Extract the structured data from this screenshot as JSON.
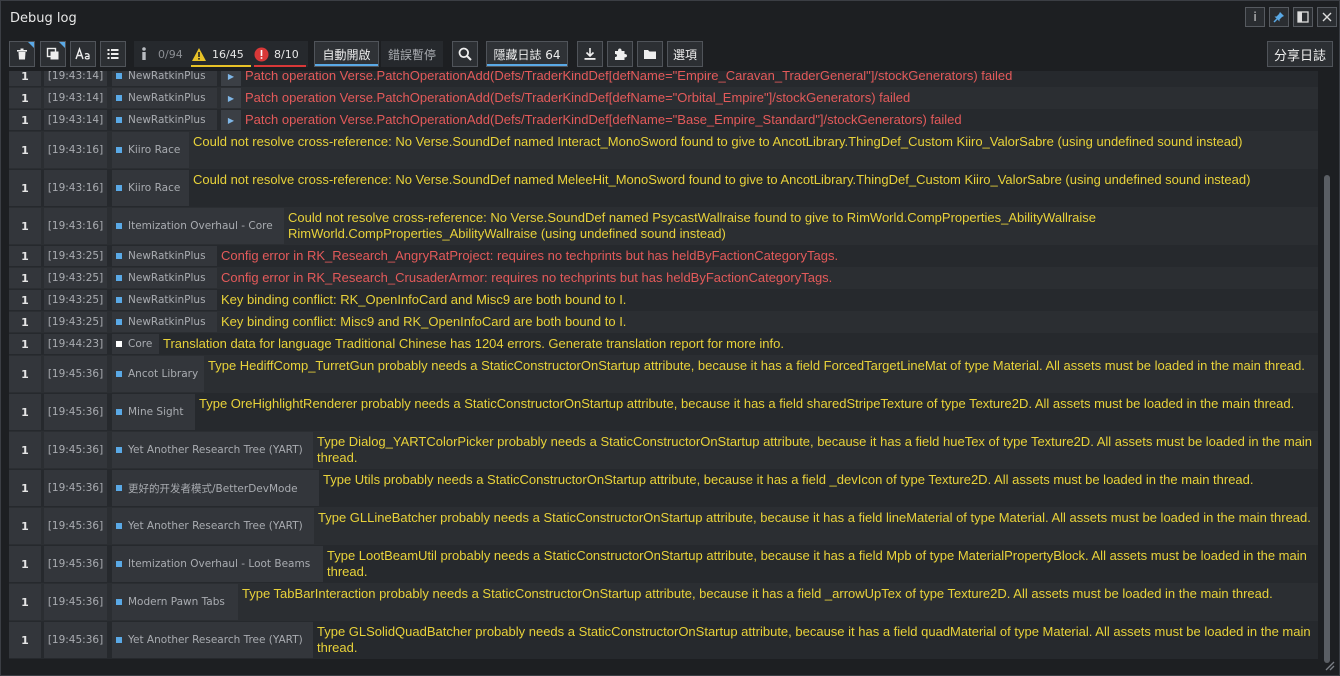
{
  "window": {
    "title": "Debug log",
    "buttons": {
      "info": "i",
      "pin": "pin-icon",
      "dock": "dock-icon",
      "close": "close-icon"
    }
  },
  "toolbar": {
    "counts": {
      "info": "0/94",
      "warning": "16/45",
      "error": "8/10"
    },
    "auto_open": "自動開啟",
    "pause_on_error": "錯誤暫停",
    "hide_logs": "隱藏日誌 64",
    "options": "選項",
    "share": "分享日誌"
  },
  "colors": {
    "error": "#e35a5a",
    "warning": "#e8d23a",
    "accent": "#5aa9e6",
    "warn_badge": "#e8c227",
    "err_badge": "#d93838"
  },
  "rows": [
    {
      "count": "1",
      "time": "[19:43:14]",
      "mod": "NewRatkinPlus",
      "expand": true,
      "type": "error",
      "message": "Patch operation Verse.PatchOperationAdd(Defs/TraderKindDef[defName=\"Empire_Caravan_TraderGeneral\"]/stockGenerators) failed"
    },
    {
      "count": "1",
      "time": "[19:43:14]",
      "mod": "NewRatkinPlus",
      "expand": true,
      "type": "error",
      "message": "Patch operation Verse.PatchOperationAdd(Defs/TraderKindDef[defName=\"Orbital_Empire\"]/stockGenerators) failed"
    },
    {
      "count": "1",
      "time": "[19:43:14]",
      "mod": "NewRatkinPlus",
      "expand": true,
      "type": "error",
      "message": "Patch operation Verse.PatchOperationAdd(Defs/TraderKindDef[defName=\"Base_Empire_Standard\"]/stockGenerators) failed"
    },
    {
      "count": "1",
      "time": "[19:43:16]",
      "mod": "Kiiro Race",
      "type": "warn",
      "message": "Could not resolve cross-reference: No Verse.SoundDef named Interact_MonoSword found to give to AncotLibrary.ThingDef_Custom Kiiro_ValorSabre (using undefined sound instead)"
    },
    {
      "count": "1",
      "time": "[19:43:16]",
      "mod": "Kiiro Race",
      "type": "warn",
      "message": "Could not resolve cross-reference: No Verse.SoundDef named MeleeHit_MonoSword found to give to AncotLibrary.ThingDef_Custom Kiiro_ValorSabre (using undefined sound instead)"
    },
    {
      "count": "1",
      "time": "[19:43:16]",
      "mod": "Itemization Overhaul - Core",
      "type": "warn",
      "message": "Could not resolve cross-reference: No Verse.SoundDef named PsycastWallraise found to give to RimWorld.CompProperties_AbilityWallraise RimWorld.CompProperties_AbilityWallraise (using undefined sound instead)"
    },
    {
      "count": "1",
      "time": "[19:43:25]",
      "mod": "NewRatkinPlus",
      "type": "error",
      "message": "Config error in RK_Research_AngryRatProject: requires no techprints but has heldByFactionCategoryTags."
    },
    {
      "count": "1",
      "time": "[19:43:25]",
      "mod": "NewRatkinPlus",
      "type": "error",
      "message": "Config error in RK_Research_CrusaderArmor: requires no techprints but has heldByFactionCategoryTags."
    },
    {
      "count": "1",
      "time": "[19:43:25]",
      "mod": "NewRatkinPlus",
      "type": "warn",
      "message": "Key binding conflict: RK_OpenInfoCard and Misc9 are both bound to I."
    },
    {
      "count": "1",
      "time": "[19:43:25]",
      "mod": "NewRatkinPlus",
      "type": "warn",
      "message": "Key binding conflict: Misc9 and RK_OpenInfoCard are both bound to I."
    },
    {
      "count": "1",
      "time": "[19:44:23]",
      "mod": "Core",
      "type": "warn",
      "message": "Translation data for language Traditional Chinese has 1204 errors. Generate translation report for more info."
    },
    {
      "count": "1",
      "time": "[19:45:36]",
      "mod": "Ancot Library",
      "type": "warn",
      "message": "Type HediffComp_TurretGun probably needs a StaticConstructorOnStartup attribute, because it has a field ForcedTargetLineMat of type Material. All assets must be loaded in the main thread."
    },
    {
      "count": "1",
      "time": "[19:45:36]",
      "mod": "Mine Sight",
      "type": "warn",
      "message": "Type OreHighlightRenderer probably needs a StaticConstructorOnStartup attribute, because it has a field sharedStripeTexture of type Texture2D. All assets must be loaded in the main thread."
    },
    {
      "count": "1",
      "time": "[19:45:36]",
      "mod": "Yet Another Research Tree (YART)",
      "type": "warn",
      "message": "Type Dialog_YARTColorPicker probably needs a StaticConstructorOnStartup attribute, because it has a field hueTex of type Texture2D. All assets must be loaded in the main thread."
    },
    {
      "count": "1",
      "time": "[19:45:36]",
      "mod": "更好的开发者模式/BetterDevMode",
      "type": "warn",
      "message": "Type Utils probably needs a StaticConstructorOnStartup attribute, because it has a field _devIcon of type Texture2D. All assets must be loaded in the main thread."
    },
    {
      "count": "1",
      "time": "[19:45:36]",
      "mod": "Yet Another Research Tree (YART)",
      "type": "warn",
      "message": "Type GLLineBatcher probably needs a StaticConstructorOnStartup attribute, because it has a field lineMaterial of type Material. All assets must be loaded in the main thread."
    },
    {
      "count": "1",
      "time": "[19:45:36]",
      "mod": "Itemization Overhaul - Loot Beams",
      "type": "warn",
      "message": "Type LootBeamUtil probably needs a StaticConstructorOnStartup attribute, because it has a field Mpb of type MaterialPropertyBlock. All assets must be loaded in the main thread."
    },
    {
      "count": "1",
      "time": "[19:45:36]",
      "mod": "Modern Pawn Tabs",
      "type": "warn",
      "message": "Type TabBarInteraction probably needs a StaticConstructorOnStartup attribute, because it has a field _arrowUpTex of type Texture2D. All assets must be loaded in the main thread."
    },
    {
      "count": "1",
      "time": "[19:45:36]",
      "mod": "Yet Another Research Tree (YART)",
      "type": "warn",
      "message": "Type GLSolidQuadBatcher probably needs a StaticConstructorOnStartup attribute, because it has a field quadMaterial of type Material. All assets must be loaded in the main thread."
    }
  ]
}
